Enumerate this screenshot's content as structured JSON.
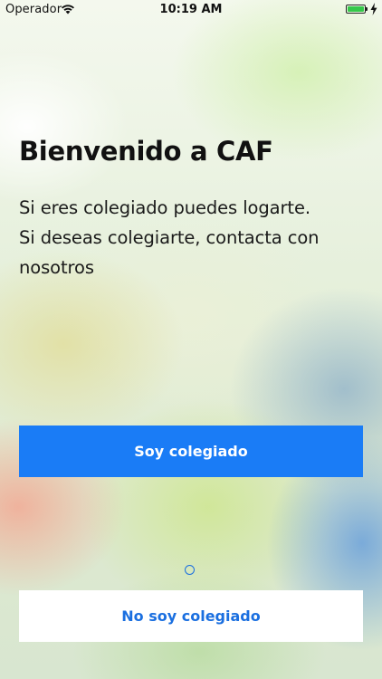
{
  "status_bar": {
    "carrier": "Operador",
    "time": "10:19 AM",
    "battery_color": "#35c84a"
  },
  "welcome": {
    "title": "Bienvenido a CAF",
    "description_lines": [
      "Si eres colegiado puedes logarte.",
      "Si deseas colegiarte, contacta con",
      "nosotros"
    ]
  },
  "buttons": {
    "member_label": "Soy colegiado",
    "non_member_label": "No soy colegiado"
  },
  "colors": {
    "primary": "#1a7cf6",
    "link": "#1a6fe0"
  },
  "icons": [
    "wifi-icon",
    "battery-icon",
    "charging-bolt-icon",
    "activity-indicator"
  ]
}
